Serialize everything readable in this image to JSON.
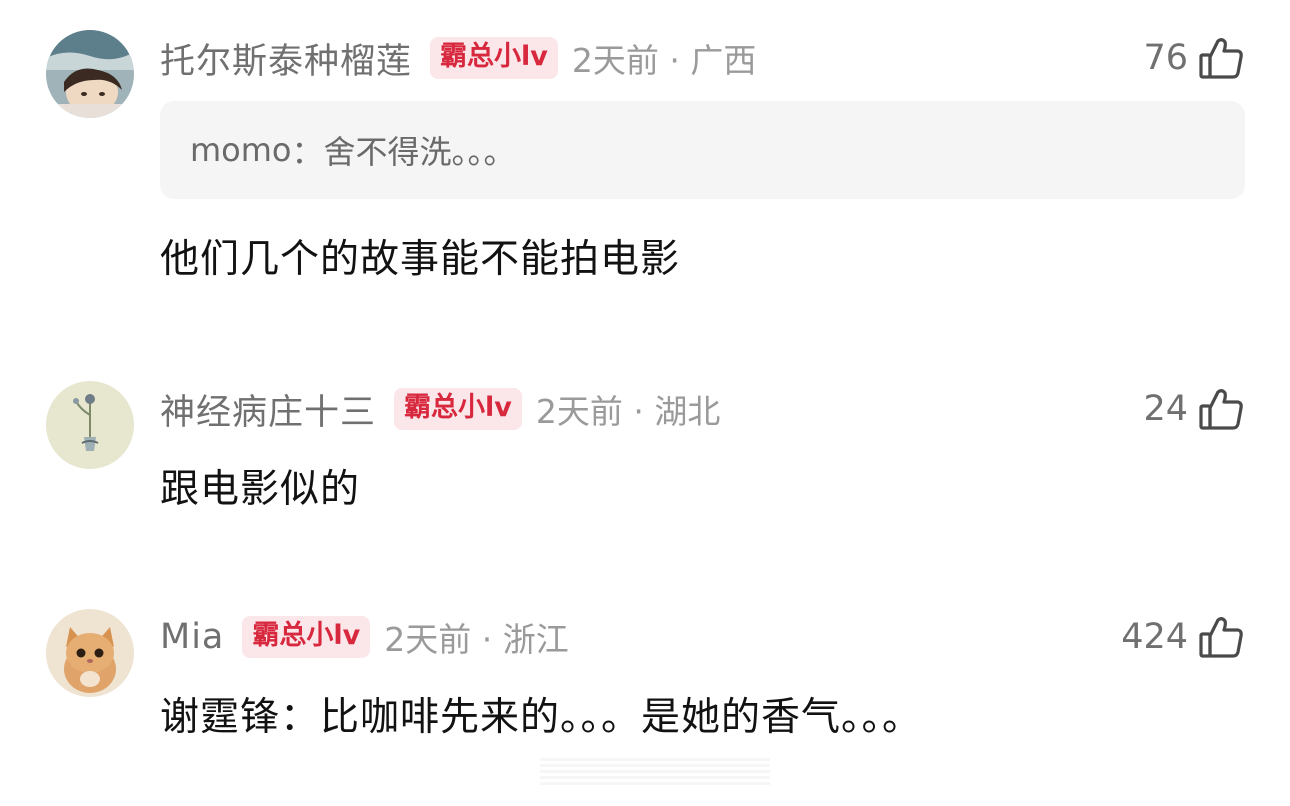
{
  "comments": [
    {
      "username": "托尔斯泰种榴莲",
      "badge": "霸总小lv",
      "meta": "2天前 · 广西",
      "likes": "76",
      "quote": {
        "user": "momo",
        "sep": "：",
        "text": "舍不得洗。。。"
      },
      "text": "他们几个的故事能不能拍电影",
      "avatar_icon": "avatar-photo-person"
    },
    {
      "username": "神经病庄十三",
      "badge": "霸总小lv",
      "meta": "2天前 · 湖北",
      "likes": "24",
      "text": "跟电影似的",
      "avatar_icon": "avatar-photo-flower"
    },
    {
      "username": "Mia",
      "badge": "霸总小lv",
      "meta": "2天前 · 浙江",
      "likes": "424",
      "text": "谢霆锋：比咖啡先来的。。。是她的香气。。。",
      "avatar_icon": "avatar-photo-kitten"
    }
  ],
  "icons": {
    "like": "thumbs-up-icon"
  },
  "colors": {
    "badge_bg": "#fbe6ea",
    "badge_text": "#d8283e",
    "quote_bg": "#f5f5f5"
  }
}
